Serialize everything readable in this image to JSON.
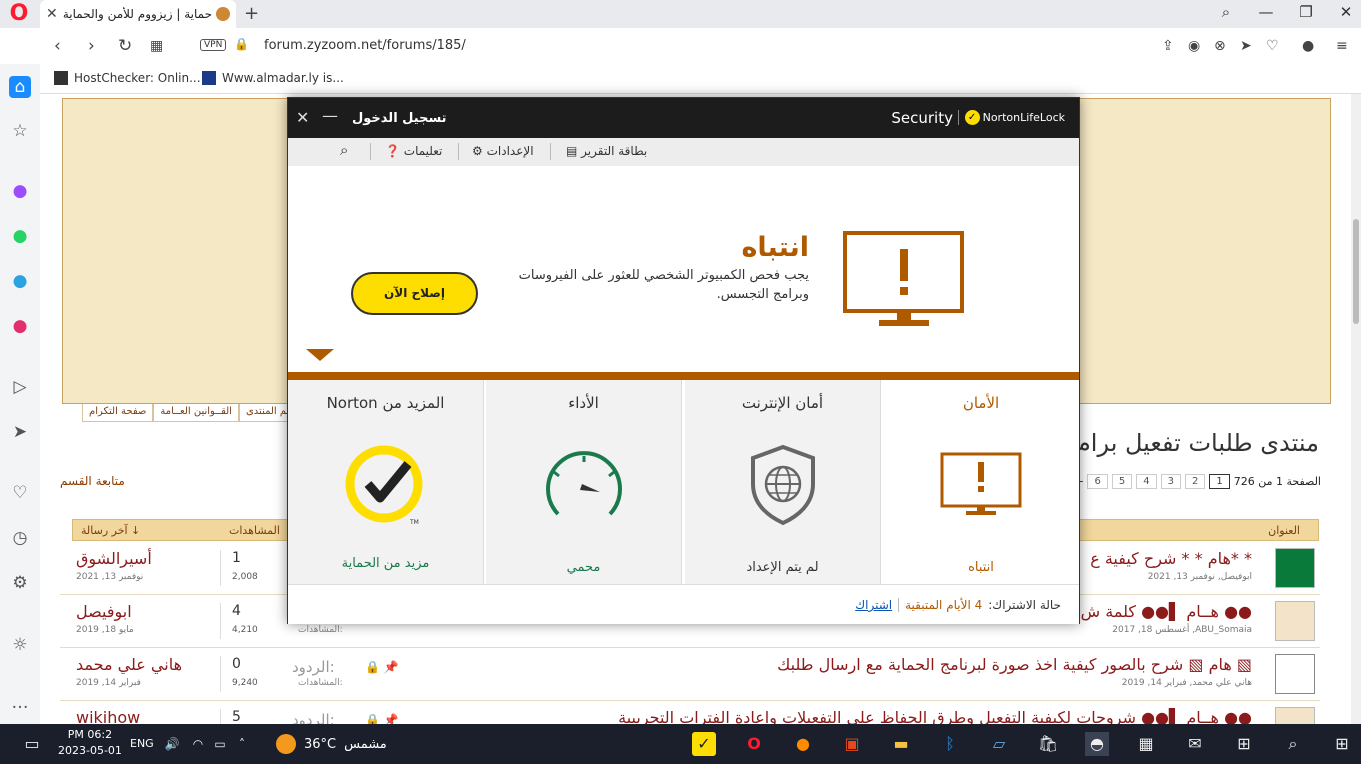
{
  "browser": {
    "tab_title": "حماية | زيزووم للأمن والحماية",
    "url": "forum.zyzoom.net/forums/185/",
    "vpn_label": "VPN",
    "bookmarks": [
      {
        "label": "HostChecker: Onlin..."
      },
      {
        "label": "Www.almadar.ly is..."
      }
    ]
  },
  "forum": {
    "title": "منتدى طلبات تفعيل برام",
    "follow_label": "متابعة القسم",
    "tabs": [
      "دعم المنتدى",
      "القــوانين العــامة",
      "صفحة التكرام"
    ],
    "pagination": {
      "label": "الصفحة 1 من 726",
      "pages": [
        "1",
        "2",
        "3",
        "4",
        "5",
        "6"
      ],
      "next": "←"
    },
    "columns": {
      "title": "العنوان",
      "views": "المشاهدات",
      "last": "آخر رسالة ↓"
    },
    "rows": [
      {
        "title": "* *هام * * شرح كيفية ع",
        "meta": "ابوفيصل, نوفمبر 13, 2021",
        "replies": "1",
        "views": "2,008",
        "last_user": "أسيرالشوق",
        "last_date": "نوفمبر 13, 2021",
        "replies_label": "",
        "views_label": ""
      },
      {
        "title": "●● هــام ▌●● كلمة ش",
        "meta": "ABU_Somaia, أغسطس 18, 2017",
        "replies": "4",
        "views": "4,210",
        "last_user": "ابوفيصل",
        "last_date": "مايو 18, 2019",
        "replies_label": "",
        "views_label": "المشاهدات:"
      },
      {
        "title": "▧ هام ▧ شرح بالصور كيفية اخذ صورة لبرنامج الحماية مع ارسال طلبك",
        "meta": "هاني علي محمد, فبراير 14, 2019",
        "replies": "0",
        "views": "9,240",
        "last_user": "هاني علي محمد",
        "last_date": "فبراير 14, 2019",
        "replies_label": "الردود:",
        "views_label": "المشاهدات:"
      },
      {
        "title": "●● هــام ▌●● شروحات لكيفية التفعيل وطرق الحفاظ على التفعيلات واعادة الفترات التجريبية",
        "meta": "",
        "replies": "5",
        "views": "",
        "last_user": "wikihow",
        "last_date": "",
        "replies_label": "الردود:",
        "views_label": ""
      }
    ]
  },
  "norton": {
    "window_title": "تسجيل الدخول",
    "product": "Security",
    "brand": "NortonLifeLock",
    "menu": {
      "report_card": "بطاقة التقرير",
      "settings": "الإعدادات",
      "help": "تعليمات"
    },
    "alert": {
      "title": "انتباه",
      "text": "يجب فحص الكمبيوتر الشخصي للعثور على الفيروسات وبرامج التجسس.",
      "fix_button": "إصلاح الآن"
    },
    "tiles": [
      {
        "title": "الأمان",
        "status": "انتباه",
        "status_color": "#b05a00"
      },
      {
        "title": "أمان الإنترنت",
        "status": "لم يتم الإعداد",
        "status_color": "#333333"
      },
      {
        "title": "الأداء",
        "status": "محمي",
        "status_color": "#1a7a4c"
      },
      {
        "title": "المزيد من Norton",
        "status": "مزيد من الحماية",
        "status_color": "#1a7a4c"
      }
    ],
    "footer": {
      "status_label": "حالة الاشتراك:",
      "days_left": "4 الأيام المتبقية",
      "subscribe": "اشتراك"
    },
    "colors": {
      "accent": "#b05a00",
      "yellow": "#fdde00",
      "green": "#1a7a4c"
    }
  },
  "taskbar": {
    "time": "PM 06:2",
    "date": "2023-05-01",
    "lang": "ENG",
    "temp": "36°C",
    "weather": "مشمس"
  }
}
